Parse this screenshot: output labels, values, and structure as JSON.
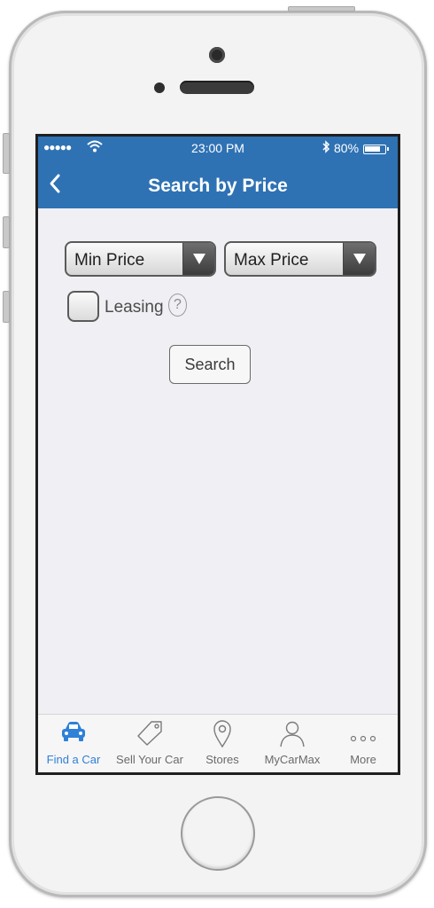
{
  "status_bar": {
    "signal": "●●●●●",
    "time": "23:00 PM",
    "battery": "80%"
  },
  "nav": {
    "title": "Search by Price"
  },
  "form": {
    "min_price": "Min Price",
    "max_price": "Max Price",
    "leasing_label": "Leasing",
    "help": "?",
    "search_button": "Search"
  },
  "tabs": [
    {
      "label": "Find a Car",
      "icon": "car-icon",
      "active": true
    },
    {
      "label": "Sell Your Car",
      "icon": "tag-icon",
      "active": false
    },
    {
      "label": "Stores",
      "icon": "map-pin-icon",
      "active": false
    },
    {
      "label": "MyCarMax",
      "icon": "person-icon",
      "active": false
    },
    {
      "label": "More",
      "icon": "more-dots-icon",
      "active": false
    }
  ],
  "colors": {
    "header": "#2f72b4",
    "active_tab": "#2f80d8",
    "background": "#efeff4"
  }
}
